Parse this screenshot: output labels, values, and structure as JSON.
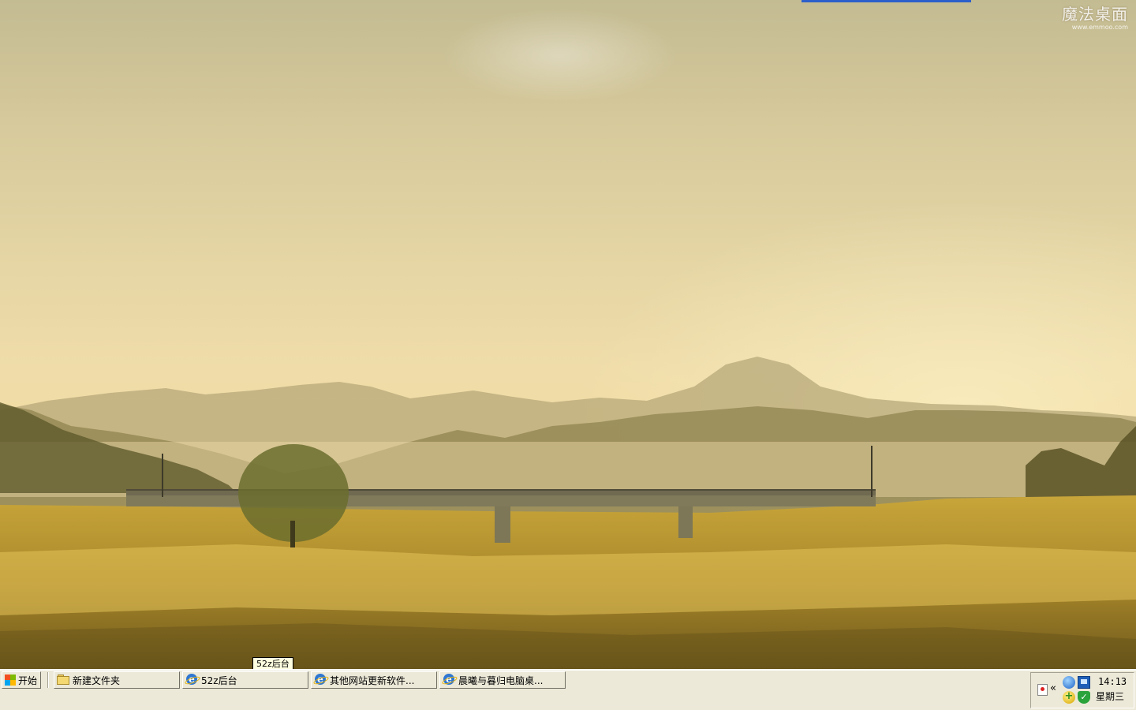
{
  "wallpaper": {
    "watermark_text": "魔法桌面",
    "watermark_url": "www.emmoo.com"
  },
  "tooltip": {
    "text": "52z后台"
  },
  "taskbar": {
    "start_label": "开始",
    "tasks": [
      {
        "label": "新建文件夹",
        "icon": "folder-icon"
      },
      {
        "label": "52z后台",
        "icon": "ie-icon"
      },
      {
        "label": "其他网站更新软件...",
        "icon": "ie-icon"
      },
      {
        "label": "晨曦与暮归电脑桌...",
        "icon": "ie-icon"
      }
    ],
    "tray": {
      "expand_glyph": "«",
      "icons": [
        "flag-icon",
        "qq-icon",
        "network-icon",
        "update-icon",
        "shield-icon"
      ],
      "time": "14:13",
      "day": "星期三"
    }
  }
}
